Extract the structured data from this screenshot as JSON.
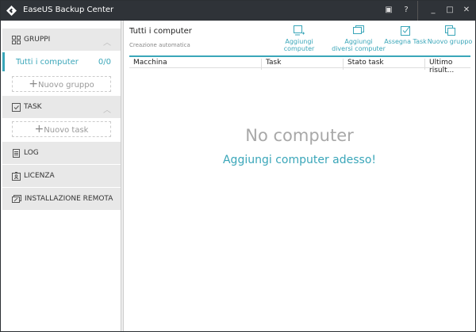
{
  "app": {
    "title": "EaseUS Backup Center",
    "accent": "#3aa6b9"
  },
  "titlebar": {
    "buttons": [
      "feedback-icon",
      "help-icon",
      "minimize-icon",
      "maximize-icon",
      "close-icon"
    ],
    "symbols": [
      "▣",
      "?",
      "_",
      "□",
      "✕"
    ]
  },
  "sidebar": {
    "groups_label": "GRUPPI",
    "all_computers": "Tutti i computer",
    "all_count": "0/0",
    "new_group": "Nuovo gruppo",
    "task_label": "TASK",
    "new_task": "Nuovo task",
    "log": "LOG",
    "license": "LICENZA",
    "remote": "INSTALLAZIONE REMOTA",
    "plus": "+",
    "chevron": "︿"
  },
  "main": {
    "title": "Tutti i computer",
    "subtitle": "Creazione automatica",
    "actions": {
      "add_computer": "Aggiungi computer",
      "add_multi_1": "Aggiungi",
      "add_multi_2": "diversi computer",
      "assign_task": "Assegna Task",
      "new_group": "Nuovo gruppo"
    },
    "columns": [
      "Macchina",
      "Task",
      "Stato task",
      "Ultimo risult..."
    ],
    "empty_title": "No computer",
    "empty_link": "Aggiungi computer adesso!"
  }
}
